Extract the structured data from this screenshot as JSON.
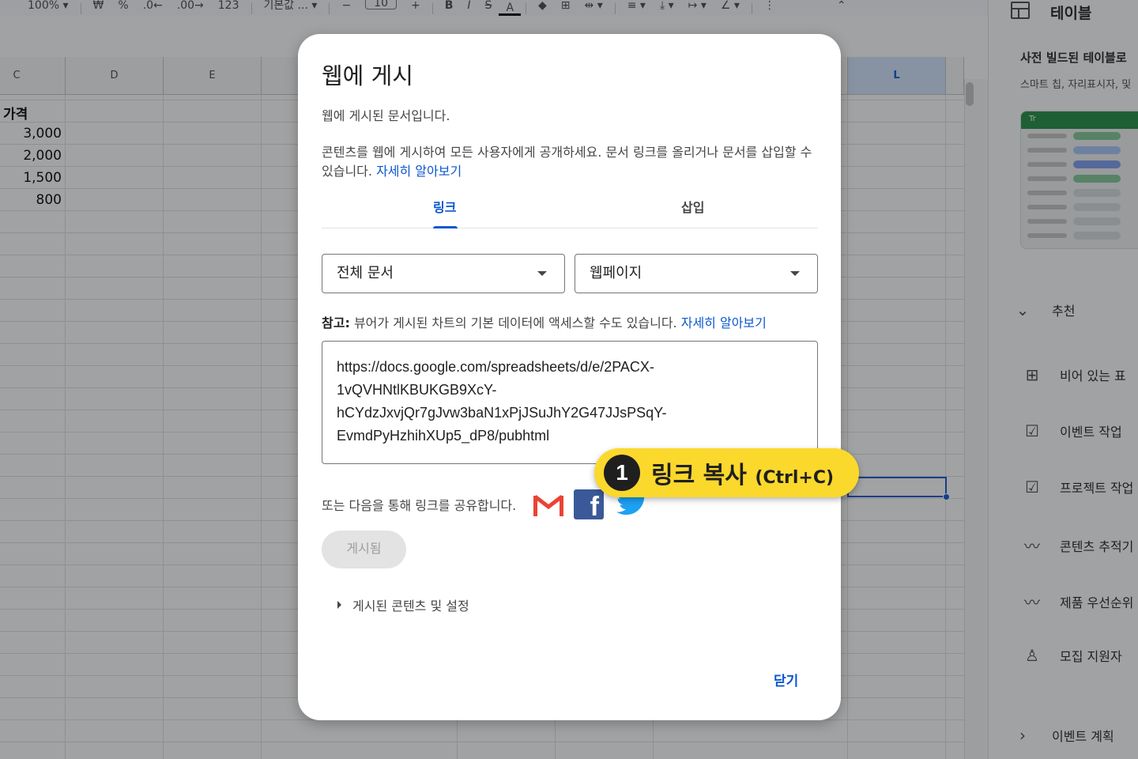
{
  "toolbar": {
    "zoom": "100%",
    "currency": "₩",
    "percent": "%",
    "dec_decrease": ".0←",
    "dec_increase": ".00→",
    "format_123": "123",
    "font": "기본값 ...",
    "minus": "−",
    "font_size": "10",
    "plus": "+",
    "bold": "B",
    "italic": "I",
    "strike": "S",
    "text_color": "A"
  },
  "sheet": {
    "columns": [
      "C",
      "D",
      "E",
      "L"
    ],
    "price_header": "가격",
    "prices": [
      "3,000",
      "2,000",
      "1,500",
      "800"
    ]
  },
  "panel": {
    "title": "테이블",
    "prebuilt_title": "사전 빌드된 테이블로",
    "prebuilt_desc": "스마트 칩, 자리표시자, 및",
    "thumb_header": "Tr",
    "recommended": "추천",
    "items": [
      "비어 있는 표",
      "이벤트 작업",
      "프로젝트 작업",
      "콘텐츠 추적기",
      "제품 우선순위",
      "모집 지원자"
    ],
    "event_plan": "이벤트 계획"
  },
  "dialog": {
    "title": "웹에 게시",
    "status": "웹에 게시된 문서입니다.",
    "description": "콘텐츠를 웹에 게시하여 모든 사용자에게 공개하세요. 문서 링크를 올리거나 문서를 삽입할 수 있습니다.",
    "learn_more": "자세히 알아보기",
    "tabs": [
      "링크",
      "삽입"
    ],
    "select_doc": "전체 문서",
    "select_format": "웹페이지",
    "note_label": "참고:",
    "note_text": "뷰어가 게시된 차트의 기본 데이터에 액세스할 수도 있습니다.",
    "note_link": "자세히 알아보기",
    "url": "https://docs.google.com/spreadsheets/d/e/2PACX-\n1vQVHNtlKBUKGB9XcY-\nhCYdzJxvjQr7gJvw3baN1xPjJSuJhY2G47JJsPSqY-\nEvmdPyHzhihXUp5_dP8/pubhtml",
    "share_text": "또는 다음을 통해 링크를 공유합니다.",
    "published_button": "게시됨",
    "expander": "게시된 콘텐츠 및 설정",
    "close": "닫기"
  },
  "callout": {
    "number": "1",
    "text": "링크 복사",
    "shortcut": "(Ctrl+C)"
  },
  "colors": {
    "accent": "#0b57d0",
    "callout": "#fbd82c",
    "gmail_red": "#ea4335",
    "facebook": "#3b5998",
    "twitter": "#1da1f2"
  }
}
